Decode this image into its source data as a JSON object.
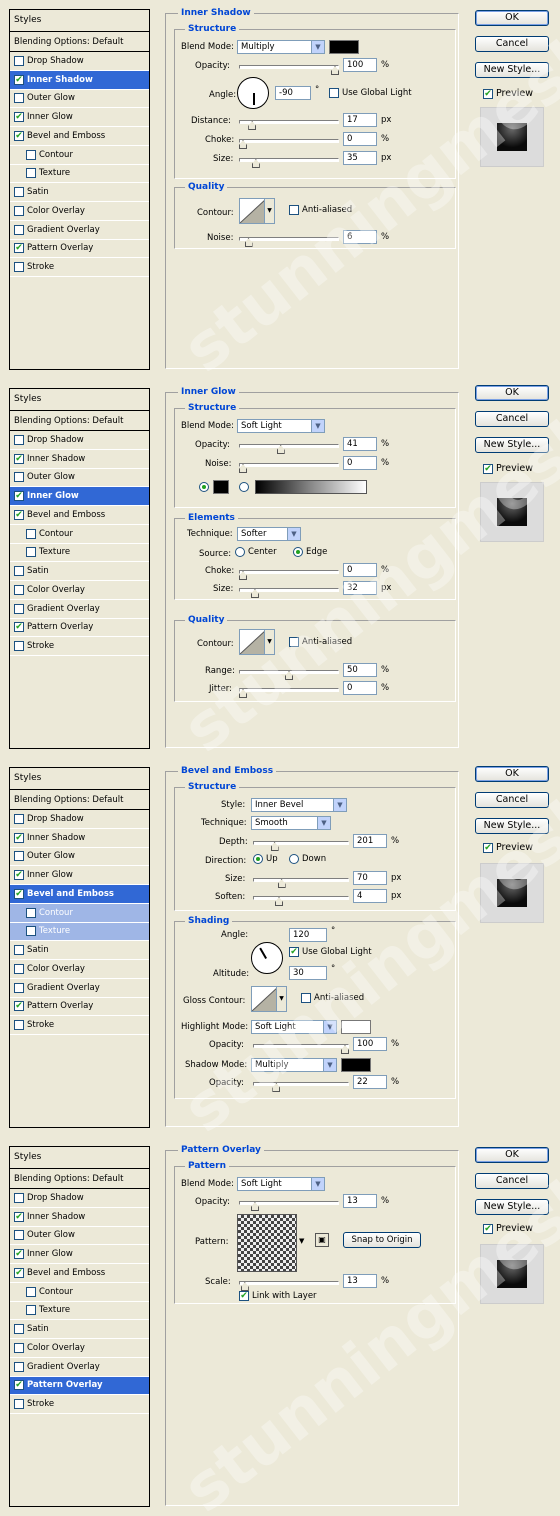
{
  "styles_header": "Styles",
  "blending": "Blending Options: Default",
  "buttons": {
    "ok": "OK",
    "cancel": "Cancel",
    "new_style": "New Style...",
    "preview": "Preview"
  },
  "panels": [
    {
      "items": [
        {
          "label": "Drop Shadow",
          "checked": false,
          "sub": false,
          "selected": false
        },
        {
          "label": "Inner Shadow",
          "checked": true,
          "sub": false,
          "selected": true
        },
        {
          "label": "Outer Glow",
          "checked": false,
          "sub": false,
          "selected": false
        },
        {
          "label": "Inner Glow",
          "checked": true,
          "sub": false,
          "selected": false
        },
        {
          "label": "Bevel and Emboss",
          "checked": true,
          "sub": false,
          "selected": false
        },
        {
          "label": "Contour",
          "checked": false,
          "sub": true,
          "selected": false
        },
        {
          "label": "Texture",
          "checked": false,
          "sub": true,
          "selected": false
        },
        {
          "label": "Satin",
          "checked": false,
          "sub": false,
          "selected": false
        },
        {
          "label": "Color Overlay",
          "checked": false,
          "sub": false,
          "selected": false
        },
        {
          "label": "Gradient Overlay",
          "checked": false,
          "sub": false,
          "selected": false
        },
        {
          "label": "Pattern Overlay",
          "checked": true,
          "sub": false,
          "selected": false
        },
        {
          "label": "Stroke",
          "checked": false,
          "sub": false,
          "selected": false
        }
      ],
      "title": "Inner Shadow",
      "structure": "Structure",
      "blend_mode_label": "Blend Mode:",
      "blend_mode": "Multiply",
      "opacity_label": "Opacity:",
      "opacity": "100",
      "opacity_pct": 1.0,
      "angle_label": "Angle:",
      "angle": "-90",
      "global_light": "Use Global Light",
      "distance_label": "Distance:",
      "distance": "17",
      "distance_pct": 0.1,
      "choke_label": "Choke:",
      "choke": "0",
      "choke_pct": 0,
      "size_label": "Size:",
      "size": "35",
      "size_pct": 0.14,
      "quality": "Quality",
      "contour_label": "Contour:",
      "anti_aliased": "Anti-aliased",
      "noise_label": "Noise:",
      "noise": "6",
      "noise_pct": 0.06,
      "pct": "%",
      "px": "px",
      "deg": "°"
    },
    {
      "items": [
        {
          "label": "Drop Shadow",
          "checked": false,
          "sub": false,
          "selected": false
        },
        {
          "label": "Inner Shadow",
          "checked": true,
          "sub": false,
          "selected": false
        },
        {
          "label": "Outer Glow",
          "checked": false,
          "sub": false,
          "selected": false
        },
        {
          "label": "Inner Glow",
          "checked": true,
          "sub": false,
          "selected": true
        },
        {
          "label": "Bevel and Emboss",
          "checked": true,
          "sub": false,
          "selected": false
        },
        {
          "label": "Contour",
          "checked": false,
          "sub": true,
          "selected": false
        },
        {
          "label": "Texture",
          "checked": false,
          "sub": true,
          "selected": false
        },
        {
          "label": "Satin",
          "checked": false,
          "sub": false,
          "selected": false
        },
        {
          "label": "Color Overlay",
          "checked": false,
          "sub": false,
          "selected": false
        },
        {
          "label": "Gradient Overlay",
          "checked": false,
          "sub": false,
          "selected": false
        },
        {
          "label": "Pattern Overlay",
          "checked": true,
          "sub": false,
          "selected": false
        },
        {
          "label": "Stroke",
          "checked": false,
          "sub": false,
          "selected": false
        }
      ],
      "title": "Inner Glow",
      "structure": "Structure",
      "blend_mode_label": "Blend Mode:",
      "blend_mode": "Soft Light",
      "opacity_label": "Opacity:",
      "opacity": "41",
      "opacity_pct": 0.41,
      "noise_label": "Noise:",
      "noise": "0",
      "noise_pct": 0,
      "elements": "Elements",
      "technique_label": "Technique:",
      "technique": "Softer",
      "source_label": "Source:",
      "center": "Center",
      "edge": "Edge",
      "choke_label": "Choke:",
      "choke": "0",
      "choke_pct": 0,
      "size_label": "Size:",
      "size": "32",
      "size_pct": 0.13,
      "quality": "Quality",
      "contour_label": "Contour:",
      "anti_aliased": "Anti-aliased",
      "range_label": "Range:",
      "range": "50",
      "range_pct": 0.5,
      "jitter_label": "Jitter:",
      "jitter": "0",
      "jitter_pct": 0,
      "pct": "%",
      "px": "px"
    },
    {
      "items": [
        {
          "label": "Drop Shadow",
          "checked": false,
          "sub": false,
          "selected": false
        },
        {
          "label": "Inner Shadow",
          "checked": true,
          "sub": false,
          "selected": false
        },
        {
          "label": "Outer Glow",
          "checked": false,
          "sub": false,
          "selected": false
        },
        {
          "label": "Inner Glow",
          "checked": true,
          "sub": false,
          "selected": false
        },
        {
          "label": "Bevel and Emboss",
          "checked": true,
          "sub": false,
          "selected": true
        },
        {
          "label": "Contour",
          "checked": false,
          "sub": true,
          "selected": false,
          "hl": true
        },
        {
          "label": "Texture",
          "checked": false,
          "sub": true,
          "selected": false,
          "hl": true
        },
        {
          "label": "Satin",
          "checked": false,
          "sub": false,
          "selected": false
        },
        {
          "label": "Color Overlay",
          "checked": false,
          "sub": false,
          "selected": false
        },
        {
          "label": "Gradient Overlay",
          "checked": false,
          "sub": false,
          "selected": false
        },
        {
          "label": "Pattern Overlay",
          "checked": true,
          "sub": false,
          "selected": false
        },
        {
          "label": "Stroke",
          "checked": false,
          "sub": false,
          "selected": false
        }
      ],
      "title": "Bevel and Emboss",
      "structure": "Structure",
      "style_label": "Style:",
      "style": "Inner Bevel",
      "technique_label": "Technique:",
      "technique": "Smooth",
      "depth_label": "Depth:",
      "depth": "201",
      "depth_pct": 0.2,
      "direction_label": "Direction:",
      "up": "Up",
      "down": "Down",
      "size_label": "Size:",
      "size": "70",
      "size_pct": 0.28,
      "soften_label": "Soften:",
      "soften": "4",
      "soften_pct": 0.25,
      "shading": "Shading",
      "angle_label": "Angle:",
      "angle": "120",
      "global_light": "Use Global Light",
      "altitude_label": "Altitude:",
      "altitude": "30",
      "gloss_label": "Gloss Contour:",
      "anti_aliased": "Anti-aliased",
      "highlight_label": "Highlight Mode:",
      "highlight_mode": "Soft Light",
      "opacity_label": "Opacity:",
      "hl_opacity": "100",
      "hl_opacity_pct": 1.0,
      "shadow_label": "Shadow Mode:",
      "shadow_mode": "Multiply",
      "sh_opacity": "22",
      "sh_opacity_pct": 0.22,
      "pct": "%",
      "px": "px",
      "deg": "°"
    },
    {
      "items": [
        {
          "label": "Drop Shadow",
          "checked": false,
          "sub": false,
          "selected": false
        },
        {
          "label": "Inner Shadow",
          "checked": true,
          "sub": false,
          "selected": false
        },
        {
          "label": "Outer Glow",
          "checked": false,
          "sub": false,
          "selected": false
        },
        {
          "label": "Inner Glow",
          "checked": true,
          "sub": false,
          "selected": false
        },
        {
          "label": "Bevel and Emboss",
          "checked": true,
          "sub": false,
          "selected": false
        },
        {
          "label": "Contour",
          "checked": false,
          "sub": true,
          "selected": false
        },
        {
          "label": "Texture",
          "checked": false,
          "sub": true,
          "selected": false
        },
        {
          "label": "Satin",
          "checked": false,
          "sub": false,
          "selected": false
        },
        {
          "label": "Color Overlay",
          "checked": false,
          "sub": false,
          "selected": false
        },
        {
          "label": "Gradient Overlay",
          "checked": false,
          "sub": false,
          "selected": false
        },
        {
          "label": "Pattern Overlay",
          "checked": true,
          "sub": false,
          "selected": true
        },
        {
          "label": "Stroke",
          "checked": false,
          "sub": false,
          "selected": false
        }
      ],
      "title": "Pattern Overlay",
      "structure": "Pattern",
      "blend_mode_label": "Blend Mode:",
      "blend_mode": "Soft Light",
      "opacity_label": "Opacity:",
      "opacity": "13",
      "opacity_pct": 0.13,
      "pattern_label": "Pattern:",
      "snap": "Snap to Origin",
      "scale_label": "Scale:",
      "scale": "13",
      "scale_pct": 0.02,
      "link": "Link with Layer",
      "pct": "%"
    }
  ],
  "watermark": "stunningmesh.com",
  "colors": {
    "accent": "#0046d5",
    "selected": "#3168d5",
    "bg": "#ece9d8"
  }
}
